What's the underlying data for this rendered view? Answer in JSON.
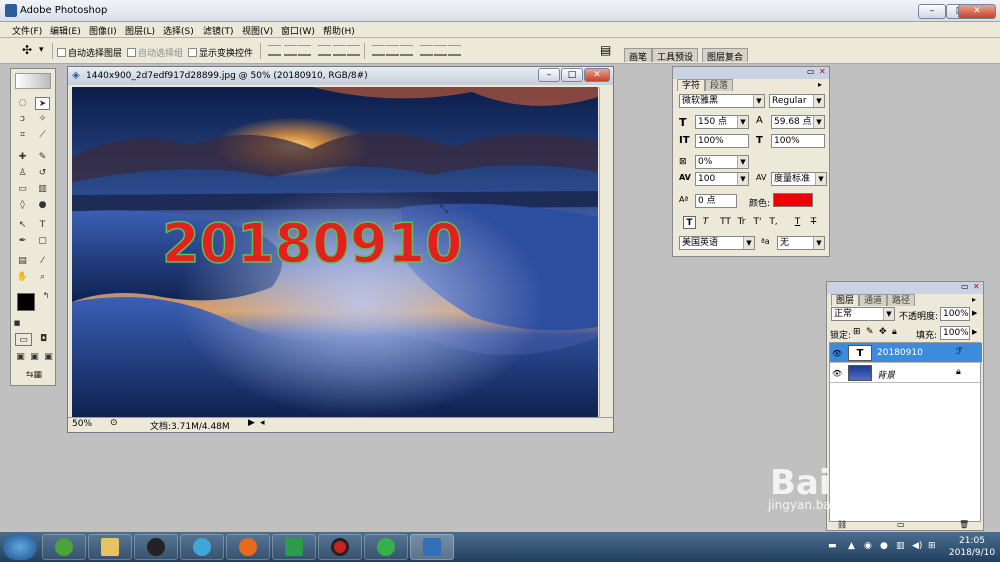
{
  "app": {
    "title": "Adobe Photoshop",
    "min": "–",
    "max": "□",
    "close": "✕"
  },
  "menu": [
    "文件(F)",
    "编辑(E)",
    "图像(I)",
    "图层(L)",
    "选择(S)",
    "滤镜(T)",
    "视图(V)",
    "窗口(W)",
    "帮助(H)"
  ],
  "options": {
    "auto_select_layer": "自动选择图层",
    "auto_select_group": "自动选择组",
    "show_transform": "显示变换控件"
  },
  "palette_well": [
    "画笔",
    "工具预设",
    "图层复合"
  ],
  "document": {
    "title": "1440x900_2d7edf917d28899.jpg @ 50% (20180910, RGB/8#)",
    "zoom": "50%",
    "doc_size": "文档:3.71M/4.48M",
    "overlay_text": "20180910"
  },
  "character": {
    "tabs": [
      "字符",
      "段落"
    ],
    "font_family": "微软雅黑",
    "font_style": "Regular",
    "font_size": "150 点",
    "leading": "59.68 点",
    "vscale": "100%",
    "hscale": "100%",
    "tracking_shift": "0%",
    "tracking": "100",
    "kerning": "度量标准",
    "baseline": "0 点",
    "color_label": "颜色:",
    "color": "#ee0000",
    "language": "美国英语",
    "antialias": "无",
    "format_buttons": [
      "T",
      "T",
      "TT",
      "Tr",
      "T'",
      "T,",
      "T",
      "T"
    ]
  },
  "layers": {
    "tabs": [
      "图层",
      "通道",
      "路径"
    ],
    "blend": "正常",
    "opacity_label": "不透明度:",
    "opacity": "100%",
    "lock_label": "锁定:",
    "fill_label": "填充:",
    "fill": "100%",
    "items": [
      {
        "name": "20180910",
        "thumb": "T"
      },
      {
        "name": "背景",
        "thumb": ""
      }
    ]
  },
  "taskbar": {
    "time": "21:05",
    "date": "2018/9/10"
  },
  "watermark": {
    "main": "Bai du 经验",
    "sub": "jingyan.baidu.com"
  }
}
